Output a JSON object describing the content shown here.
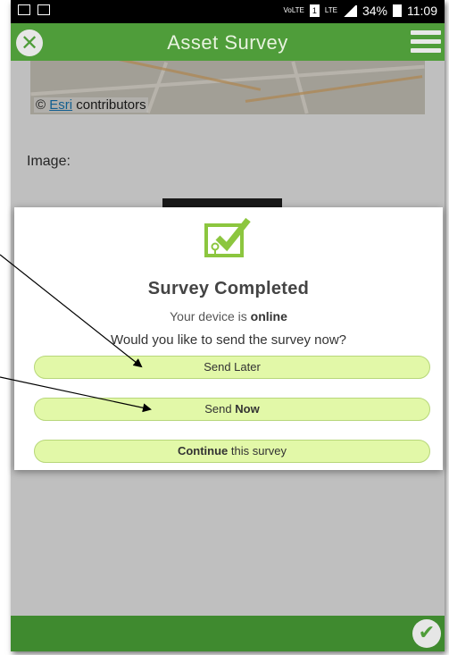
{
  "status_bar": {
    "volte": "VoLTE",
    "sim": "1",
    "network": "LTE",
    "battery": "34%",
    "time": "11:09"
  },
  "header": {
    "title": "Asset Survey",
    "close_icon": "close-circle-icon",
    "menu_icon": "hamburger-menu-icon"
  },
  "map": {
    "attribution_symbol": "©",
    "attribution_link": "Esri",
    "attribution_text": "contributors"
  },
  "form": {
    "image_label": "Image:"
  },
  "dialog": {
    "icon": "survey-check-icon",
    "title": "Survey Completed",
    "status_prefix": "Your device is",
    "status_value": "online",
    "question": "Would you like to send the survey now?",
    "send_later_label": "Send Later",
    "send_now_prefix": "Send",
    "send_now_bold": "Now",
    "continue_bold": "Continue",
    "continue_suffix": "this survey"
  },
  "footer": {
    "done_icon": "check-circle-icon"
  },
  "colors": {
    "header_green": "#4f9d3a",
    "button_fill": "#e2f8a8",
    "icon_green": "#8cc63f"
  }
}
